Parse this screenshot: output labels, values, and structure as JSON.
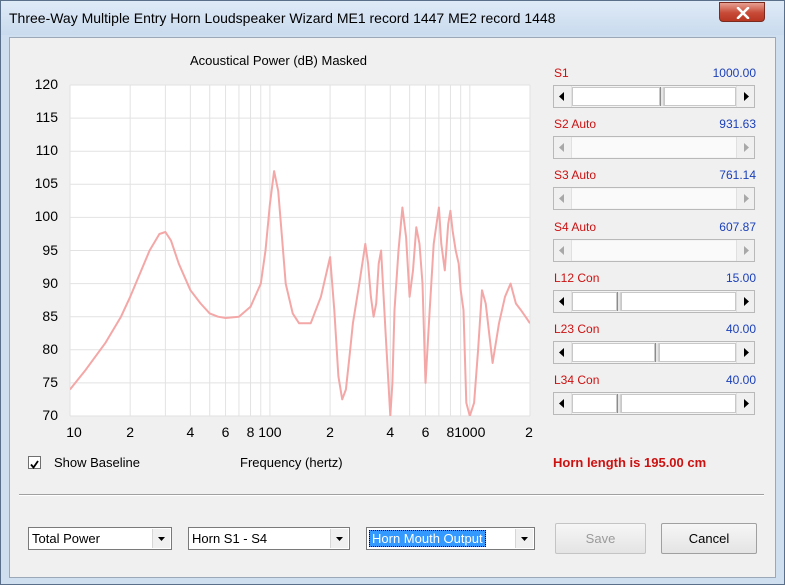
{
  "window": {
    "title": "Three-Way Multiple Entry Horn Loudspeaker Wizard   ME1 record 1447   ME2 record 1448"
  },
  "chart": {
    "title": "Acoustical Power (dB)   Masked",
    "x_axis_label": "Frequency (hertz)",
    "y_ticks": [
      "120",
      "115",
      "110",
      "105",
      "100",
      "95",
      "90",
      "85",
      "80",
      "75",
      "70"
    ],
    "x_ticks": [
      "10",
      "2",
      "4",
      "6",
      "8",
      "100",
      "2",
      "4",
      "6",
      "8",
      "1000",
      "2"
    ],
    "curve_color": "#f4a7a7"
  },
  "chart_data": {
    "type": "line",
    "x_scale": "log",
    "xlim": [
      10,
      2000
    ],
    "ylim": [
      70,
      120
    ],
    "grid": true,
    "series": [
      {
        "x": [
          10,
          12,
          15,
          18,
          20,
          22,
          25,
          28,
          30,
          32,
          35,
          40,
          45,
          50,
          55,
          60,
          70,
          80,
          90,
          95,
          100,
          105,
          110,
          115,
          120,
          130,
          140,
          160,
          180,
          200,
          210,
          220,
          230,
          240,
          250,
          260,
          280,
          300,
          310,
          320,
          330,
          340,
          350,
          360,
          380,
          400,
          410,
          420,
          440,
          460,
          480,
          500,
          520,
          540,
          560,
          580,
          600,
          630,
          660,
          700,
          720,
          750,
          780,
          800,
          820,
          850,
          880,
          900,
          930,
          960,
          1000,
          1050,
          1100,
          1150,
          1200,
          1300,
          1400,
          1500,
          1600,
          1700,
          1800,
          1900,
          2000
        ],
        "y": [
          74,
          77,
          81,
          85,
          88,
          91,
          95,
          97.5,
          97.8,
          96.5,
          93,
          89,
          87,
          85.5,
          85,
          84.8,
          85,
          86.5,
          90,
          95,
          102,
          107,
          104,
          97,
          90,
          85.5,
          84,
          84,
          88,
          94,
          86,
          76,
          72.5,
          74,
          79,
          84,
          90,
          96,
          93,
          88,
          85,
          87,
          93,
          95,
          82,
          70,
          75,
          86,
          95,
          101.5,
          97,
          88,
          92,
          98.5,
          96,
          90,
          75,
          86,
          96,
          101.5,
          96,
          92,
          99,
          101,
          98,
          95,
          93,
          89,
          86,
          72,
          70,
          72,
          80,
          89,
          87,
          78,
          84,
          88,
          90,
          87,
          86,
          85,
          84
        ]
      }
    ]
  },
  "sliders": [
    {
      "label": "S1",
      "value": "1000.00",
      "position": 0.55,
      "enabled": true
    },
    {
      "label": "S2  Auto",
      "value": "931.63",
      "position": 0.0,
      "enabled": false
    },
    {
      "label": "S3  Auto",
      "value": "761.14",
      "position": 0.0,
      "enabled": false
    },
    {
      "label": "S4  Auto",
      "value": "607.87",
      "position": 0.0,
      "enabled": false
    },
    {
      "label": "L12  Con",
      "value": "15.00",
      "position": 0.28,
      "enabled": true
    },
    {
      "label": "L23  Con",
      "value": "40.00",
      "position": 0.52,
      "enabled": true
    },
    {
      "label": "L34  Con",
      "value": "40.00",
      "position": 0.28,
      "enabled": true
    }
  ],
  "show_baseline": {
    "label": "Show Baseline",
    "checked": true
  },
  "horn_length": "Horn length is 195.00 cm",
  "dropdowns": {
    "power": "Total Power",
    "horn": "Horn S1 - S4",
    "output": "Horn Mouth Output"
  },
  "buttons": {
    "save": "Save",
    "cancel": "Cancel"
  }
}
